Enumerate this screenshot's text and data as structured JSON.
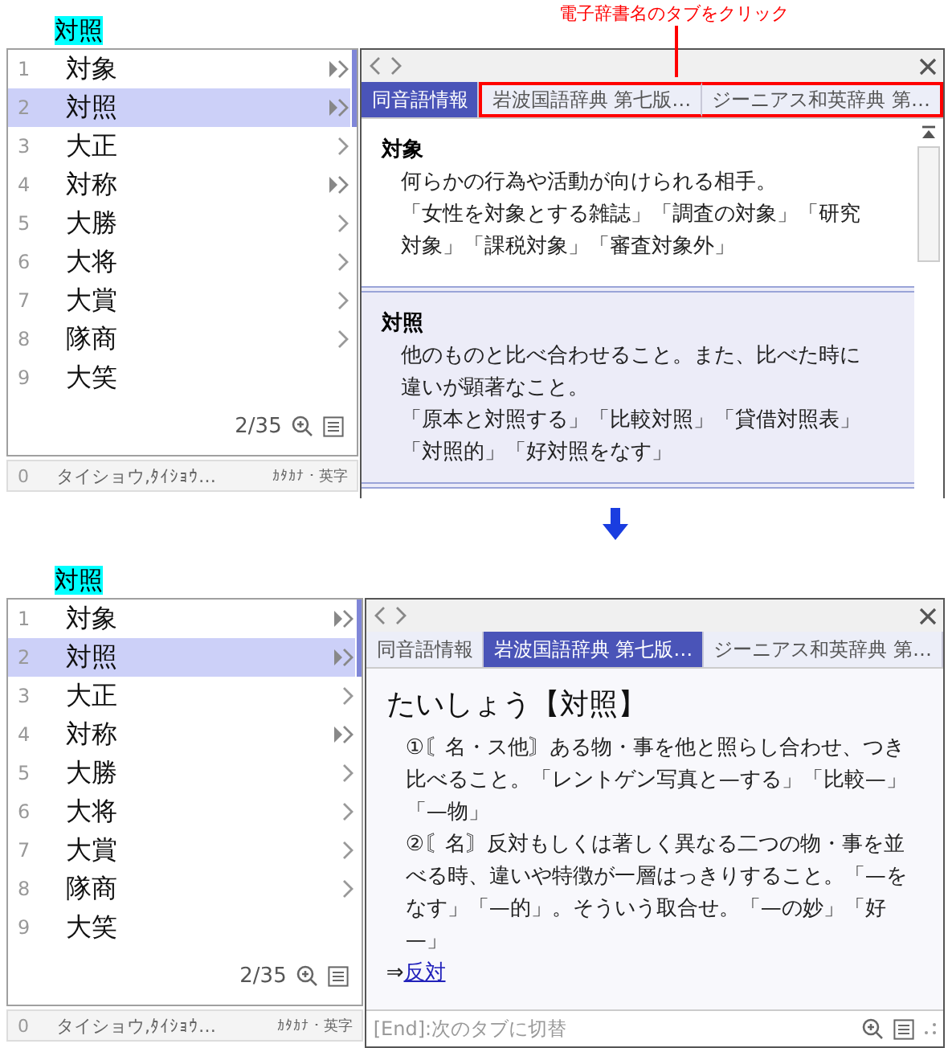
{
  "screens": [
    {
      "composition": "対照",
      "annotation": {
        "text": "電子辞書名のタブをクリック"
      },
      "candidates": [
        {
          "number": "1",
          "text": "対象",
          "kind": "double",
          "selected": false
        },
        {
          "number": "2",
          "text": "対照",
          "kind": "double",
          "selected": true
        },
        {
          "number": "3",
          "text": "大正",
          "kind": "single",
          "selected": false
        },
        {
          "number": "4",
          "text": "対称",
          "kind": "double",
          "selected": false
        },
        {
          "number": "5",
          "text": "大勝",
          "kind": "single",
          "selected": false
        },
        {
          "number": "6",
          "text": "大将",
          "kind": "single",
          "selected": false
        },
        {
          "number": "7",
          "text": "大賞",
          "kind": "single",
          "selected": false
        },
        {
          "number": "8",
          "text": "隊商",
          "kind": "single",
          "selected": false
        },
        {
          "number": "9",
          "text": "大笑",
          "kind": "plain",
          "selected": false
        }
      ],
      "page": "2/35",
      "extra_row": {
        "number": "0",
        "text": "タイショウ,ﾀｲｼｮｳ…",
        "label": "ｶﾀｶﾅ・英字"
      },
      "dictionary": {
        "tabs": [
          {
            "label": "同音語情報",
            "selected": true,
            "outlined": false
          },
          {
            "label": "岩波国語辞典 第七版…",
            "selected": false,
            "outlined": true
          },
          {
            "label": "ジーニアス和英辞典 第…",
            "selected": false,
            "outlined": true
          }
        ],
        "content": {
          "kind": "entries",
          "entries": [
            {
              "headword": "対象",
              "selected": false,
              "paragraphs": [
                "何らかの行為や活動が向けられる相手。",
                "「女性を対象とする雑誌」「調査の対象」「研究対象」「課税対象」「審査対象外」"
              ]
            },
            {
              "headword": "対照",
              "selected": true,
              "paragraphs": [
                "他のものと比べ合わせること。また、比べた時に違いが顕著なこと。",
                "「原本と対照する」「比較対照」「貸借対照表」「対照的」「好対照をなす」"
              ]
            }
          ]
        }
      }
    },
    {
      "composition": "対照",
      "candidates": [
        {
          "number": "1",
          "text": "対象",
          "kind": "double",
          "selected": false
        },
        {
          "number": "2",
          "text": "対照",
          "kind": "double",
          "selected": true
        },
        {
          "number": "3",
          "text": "大正",
          "kind": "single",
          "selected": false
        },
        {
          "number": "4",
          "text": "対称",
          "kind": "double",
          "selected": false
        },
        {
          "number": "5",
          "text": "大勝",
          "kind": "single",
          "selected": false
        },
        {
          "number": "6",
          "text": "大将",
          "kind": "single",
          "selected": false
        },
        {
          "number": "7",
          "text": "大賞",
          "kind": "single",
          "selected": false
        },
        {
          "number": "8",
          "text": "隊商",
          "kind": "single",
          "selected": false
        },
        {
          "number": "9",
          "text": "大笑",
          "kind": "plain",
          "selected": false
        }
      ],
      "page": "2/35",
      "extra_row": {
        "number": "0",
        "text": "タイショウ,ﾀｲｼｮｳ…",
        "label": "ｶﾀｶﾅ・英字"
      },
      "dictionary": {
        "tabs": [
          {
            "label": "同音語情報",
            "selected": false,
            "outlined": false
          },
          {
            "label": "岩波国語辞典 第七版…",
            "selected": true,
            "outlined": false
          },
          {
            "label": "ジーニアス和英辞典 第…",
            "selected": false,
            "outlined": false
          }
        ],
        "content": {
          "kind": "article",
          "heading": "たいしょう【対照】",
          "senses": [
            "①〘名・ス他〙ある物・事を他と照らし合わせ、つき比べること。「レントゲン写真と—する」「比較—」「—物」",
            "②〘名〙反対もしくは著しく異なる二つの物・事を並べる時、違いや特徴が一層はっきりすること。「—をなす」「—的」。そういう取合せ。「—の妙」「好—」"
          ],
          "see_also": {
            "prefix": "⇒",
            "link": "反対"
          }
        },
        "footer": "[End]:次のタブに切替"
      }
    }
  ]
}
